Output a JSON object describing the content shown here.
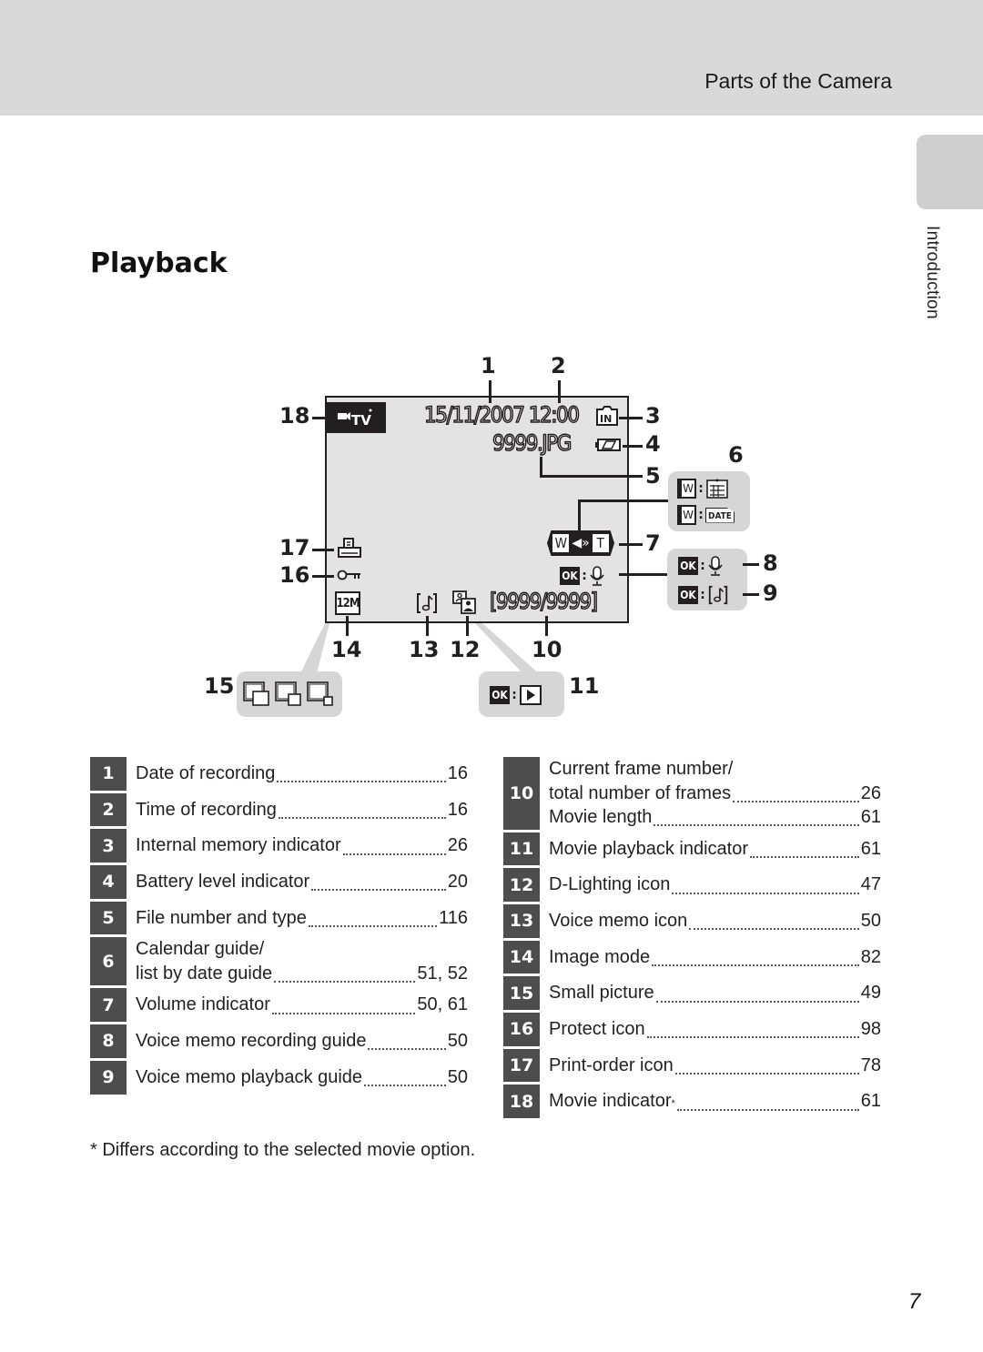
{
  "header": {
    "title": "Parts of the Camera"
  },
  "side_tab": {
    "label": "Introduction"
  },
  "page_title": "Playback",
  "diagram": {
    "screen": {
      "movie_indicator": "὏9TV",
      "date_time": "15/11/2007 12:00",
      "internal_memory": "IN",
      "file_name": "9999.JPG",
      "frame_counter": "[9999/9999]",
      "image_mode": "12M",
      "volume_w": "W",
      "volume_t": "T",
      "ok": "OK"
    },
    "guides": {
      "calendar_w": "W",
      "date_text": "DATE",
      "ok": "OK"
    },
    "callouts": [
      "1",
      "2",
      "3",
      "4",
      "5",
      "6",
      "7",
      "8",
      "9",
      "10",
      "11",
      "12",
      "13",
      "14",
      "15",
      "16",
      "17",
      "18"
    ]
  },
  "table_left": [
    {
      "num": "1",
      "lines": [
        {
          "text": "Date of recording",
          "page": "16"
        }
      ]
    },
    {
      "num": "2",
      "lines": [
        {
          "text": "Time of recording",
          "page": "16"
        }
      ]
    },
    {
      "num": "3",
      "lines": [
        {
          "text": "Internal memory indicator",
          "page": "26"
        }
      ]
    },
    {
      "num": "4",
      "lines": [
        {
          "text": "Battery level indicator",
          "page": "20"
        }
      ]
    },
    {
      "num": "5",
      "lines": [
        {
          "text": "File number and type",
          "page": "116"
        }
      ]
    },
    {
      "num": "6",
      "lines": [
        {
          "text": "Calendar guide/",
          "page": ""
        },
        {
          "text": "list by date guide",
          "page": "51, 52"
        }
      ]
    },
    {
      "num": "7",
      "lines": [
        {
          "text": "Volume indicator",
          "page": "50, 61"
        }
      ]
    },
    {
      "num": "8",
      "lines": [
        {
          "text": "Voice memo recording guide",
          "page": "50"
        }
      ]
    },
    {
      "num": "9",
      "lines": [
        {
          "text": "Voice memo playback guide",
          "page": "50"
        }
      ]
    }
  ],
  "table_right": [
    {
      "num": "10",
      "lines": [
        {
          "text": "Current frame number/",
          "page": ""
        },
        {
          "text": "total number of frames",
          "page": "26"
        },
        {
          "text": "Movie length",
          "page": "61"
        }
      ]
    },
    {
      "num": "11",
      "lines": [
        {
          "text": "Movie playback indicator",
          "page": "61"
        }
      ]
    },
    {
      "num": "12",
      "lines": [
        {
          "text": "D-Lighting icon",
          "page": "47"
        }
      ]
    },
    {
      "num": "13",
      "lines": [
        {
          "text": "Voice memo icon",
          "page": "50"
        }
      ]
    },
    {
      "num": "14",
      "lines": [
        {
          "text": "Image mode",
          "page": "82"
        }
      ]
    },
    {
      "num": "15",
      "lines": [
        {
          "text": "Small picture",
          "page": "49"
        }
      ]
    },
    {
      "num": "16",
      "lines": [
        {
          "text": "Protect icon",
          "page": "98"
        }
      ]
    },
    {
      "num": "17",
      "lines": [
        {
          "text": "Print-order icon",
          "page": "78"
        }
      ]
    },
    {
      "num": "18",
      "lines": [
        {
          "text": "Movie indicator",
          "sup": "*",
          "page": "61"
        }
      ]
    }
  ],
  "footnote": "*  Differs according to the selected movie option.",
  "page_number": "7",
  "colors": {
    "header_bg": "#d9d9d9",
    "number_cell": "#4d4d4d",
    "screen_bg": "#e3e3e3",
    "guide_box": "#d6d6d6"
  }
}
